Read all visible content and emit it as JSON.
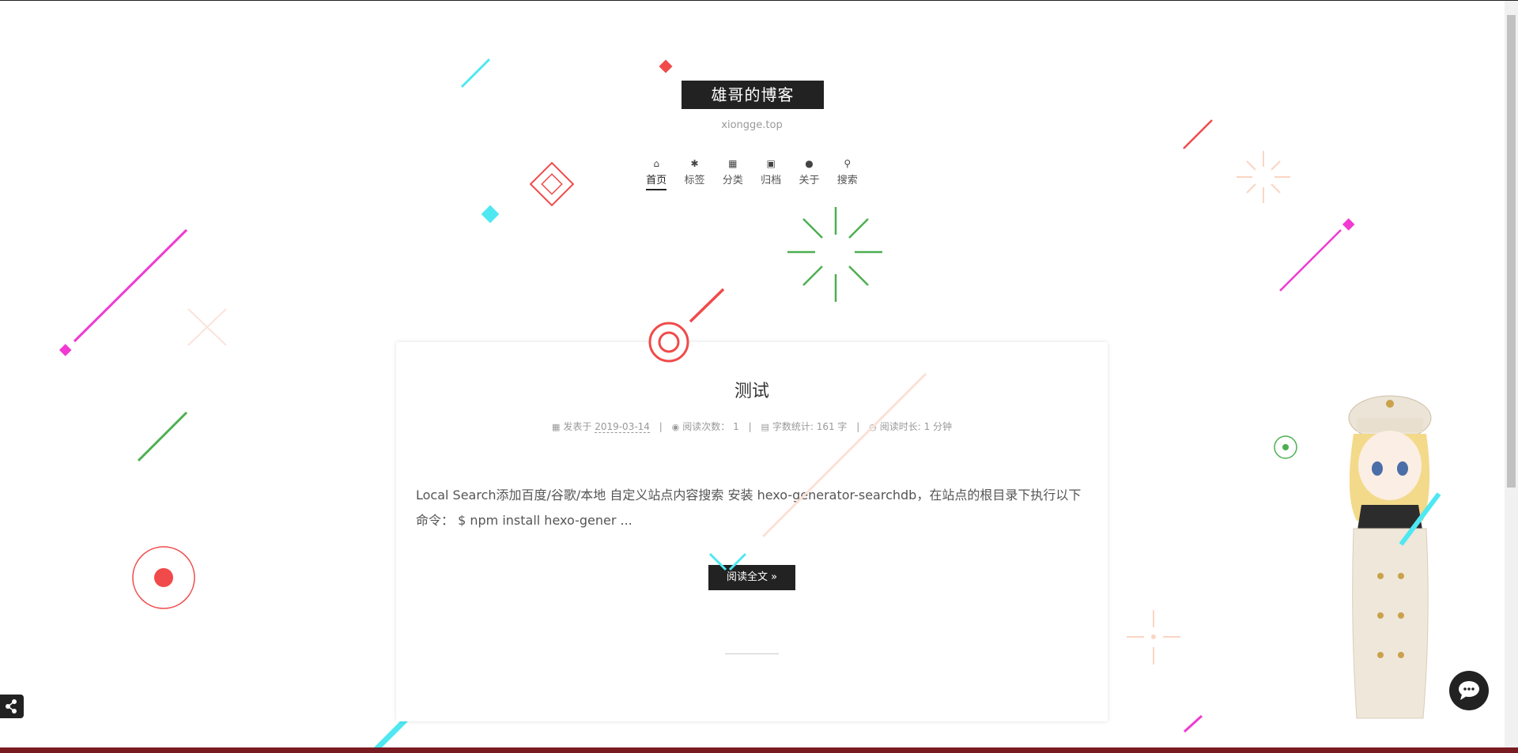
{
  "site": {
    "title": "雄哥的博客",
    "subtitle": "xiongge.top"
  },
  "menu": [
    {
      "label": "首页",
      "icon": "home-icon"
    },
    {
      "label": "标签",
      "icon": "tags-icon"
    },
    {
      "label": "分类",
      "icon": "th-icon"
    },
    {
      "label": "归档",
      "icon": "archive-icon"
    },
    {
      "label": "关于",
      "icon": "user-icon"
    },
    {
      "label": "搜索",
      "icon": "search-icon"
    }
  ],
  "post": {
    "title": "测试",
    "meta": {
      "posted_label": "发表于",
      "date": "2019-03-14",
      "views_label": "阅读次数：",
      "views": "1",
      "wordcount": "字数统计: 161 字",
      "readtime": "阅读时长: 1 分钟"
    },
    "excerpt": "Local Search添加百度/谷歌/本地 自定义站点内容搜索 安装 hexo-generator-searchdb，在站点的根目录下执行以下命令： $ npm install hexo-gener ...",
    "read_more": "阅读全文 »"
  },
  "colors": {
    "brand_bg": "#222222",
    "red": "#f04a4a",
    "cyan": "#4ee8f2",
    "magenta": "#f03ad2",
    "green": "#4caf50",
    "peach": "#fbd5c4"
  },
  "icons": {
    "calendar": "calendar-icon",
    "eye": "eye-icon",
    "file": "file-icon",
    "clock": "clock-icon",
    "share": "share-icon",
    "chat": "chat-icon"
  }
}
